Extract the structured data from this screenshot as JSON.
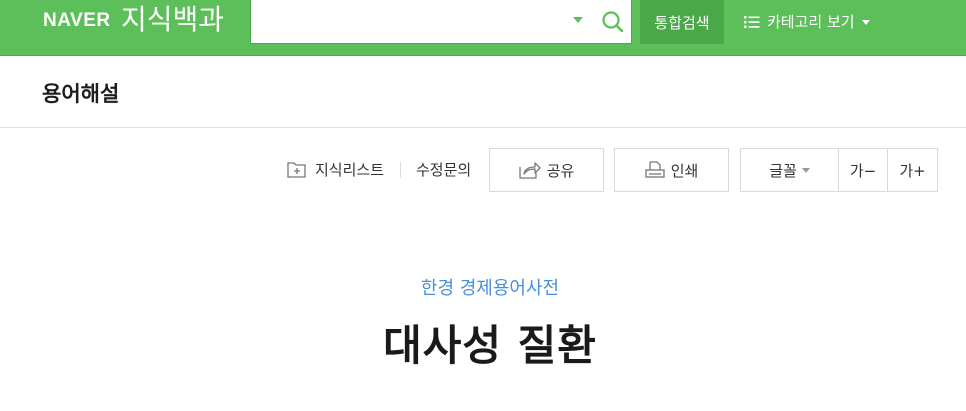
{
  "header": {
    "logo_brand": "NAVER",
    "logo_service": "지식백과",
    "search": {
      "value": "",
      "placeholder": ""
    },
    "integrated_search_label": "통합검색",
    "category_label": "카테고리 보기"
  },
  "section": {
    "title": "용어해설"
  },
  "toolbar": {
    "knowledge_list_label": "지식리스트",
    "correction_label": "수정문의",
    "share_label": "공유",
    "print_label": "인쇄",
    "font_label": "글꼴",
    "font_smaller_label": "가−",
    "font_larger_label": "가+"
  },
  "content": {
    "dictionary_name": "한경 경제용어사전",
    "entry_title": "대사성 질환"
  },
  "icons": {
    "search": "search-icon",
    "category": "list-icon",
    "knowledge_list": "folder-plus-icon",
    "share": "share-icon",
    "print": "printer-icon"
  },
  "colors": {
    "brand_green": "#5cbf5a",
    "dictionary_link": "#4a90d9"
  }
}
